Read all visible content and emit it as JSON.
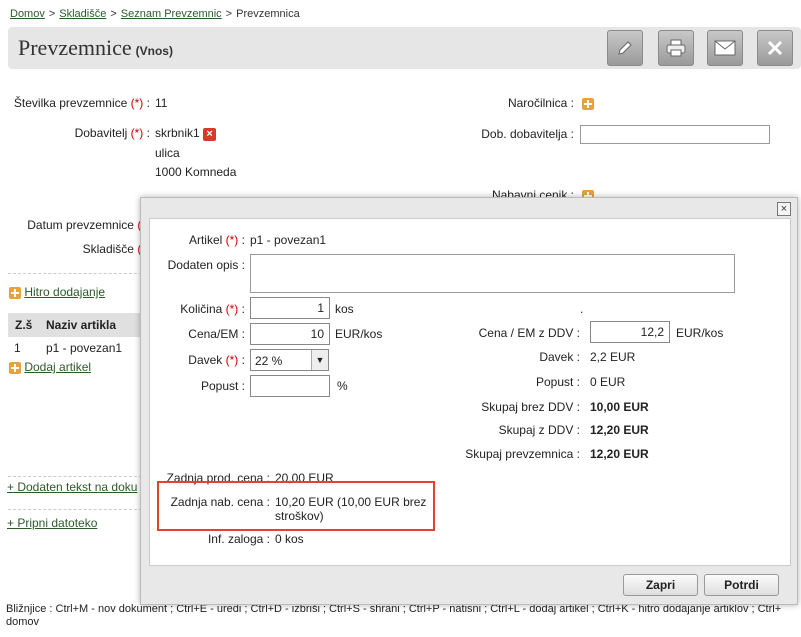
{
  "breadcrumb": {
    "items": [
      "Domov",
      "Skladišče",
      "Seznam Prevzemnic"
    ],
    "current": "Prevzemnica",
    "sep": ">"
  },
  "header": {
    "title": "Prevzemnice",
    "subtitle": "(Vnos)"
  },
  "toolbar": {
    "edit_icon": "pencil-icon",
    "print_icon": "printer-icon",
    "mail_icon": "mail-icon",
    "close_icon": "close-icon"
  },
  "form": {
    "stevilka_label": "Številka prevzemnice",
    "stevilka_value": "11",
    "dobavitelj_label": "Dobavitelj",
    "dobavitelj_name": "skrbnik1",
    "dobavitelj_street": "ulica",
    "dobavitelj_city": "1000 Komneda",
    "narocilnica_label": "Naročilnica :",
    "dob_dobavitelja_label": "Dob. dobavitelja :",
    "nabavni_cenik_label": "Nabavni cenik :",
    "datum_label": "Datum prevzemnice",
    "skladisce_label": "Skladišče",
    "req_mark": "(*)",
    "colon": ":"
  },
  "side": {
    "hitro_dodajanje": "Hitro dodajanje",
    "col_zs": "Z.š",
    "col_naziv": "Naziv artikla",
    "row_num": "1",
    "row_name": "p1 - povezan1",
    "dodaj_artikel": "Dodaj artikel",
    "dodaten_tekst": "+ Dodaten tekst na doku",
    "pripni": "+ Pripni datoteko"
  },
  "modal": {
    "artikel_label": "Artikel",
    "artikel_value": "p1 - povezan1",
    "opis_label": "Dodaten opis :",
    "opis_value": "",
    "kolicina_label": "Količina",
    "kolicina_value": "1",
    "kolicina_unit": "kos",
    "cena_label": "Cena/EM :",
    "cena_value": "10",
    "cena_unit": "EUR/kos",
    "davek_label": "Davek",
    "davek_value": "22 %",
    "popust_label": "Popust :",
    "popust_value": "",
    "popust_unit": "%",
    "dot": ".",
    "cena_ddv_label": "Cena / EM z DDV :",
    "cena_ddv_value": "12,2",
    "cena_ddv_unit": "EUR/kos",
    "davek_r_label": "Davek :",
    "davek_r_value": "2,2 EUR",
    "popust_r_label": "Popust :",
    "popust_r_value": "0 EUR",
    "skupaj_brez_label": "Skupaj brez DDV :",
    "skupaj_brez_value": "10,00 EUR",
    "skupaj_z_label": "Skupaj z DDV :",
    "skupaj_z_value": "12,20 EUR",
    "skupaj_prev_label": "Skupaj prevzemnica :",
    "skupaj_prev_value": "12,20 EUR",
    "zadnja_prod_label": "Zadnja prod. cena :",
    "zadnja_prod_value": "20,00 EUR",
    "zadnja_nab_label": "Zadnja nab. cena :",
    "zadnja_nab_value": "10,20 EUR (10,00 EUR brez stroškov)",
    "zaloga_label": "Inf. zaloga :",
    "zaloga_value": "0 kos",
    "zapri": "Zapri",
    "potrdi": "Potrdi",
    "close_glyph": "×"
  },
  "shortcuts": {
    "text": "Bližnjice : Ctrl+M - nov dokument ; Ctrl+E - uredi ; Ctrl+D - izbriši ; Ctrl+S - shrani ; Ctrl+P - natisni ; Ctrl+L - dodaj artikel ; Ctrl+K - hitro dodajanje artiklov ; Ctrl+ domov"
  },
  "colors": {
    "accent_green": "#2a5a2a",
    "highlight_red": "#e0452a",
    "plus_orange": "#e8a23a"
  }
}
